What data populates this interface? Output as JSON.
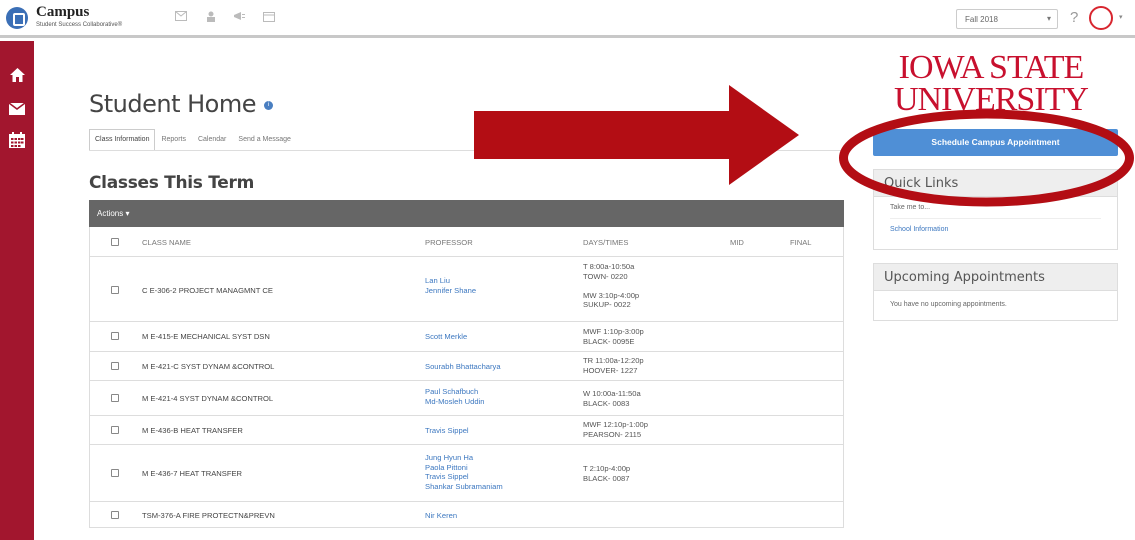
{
  "header": {
    "brand": "Campus",
    "brand_sub": "Student Success Collaborative®",
    "term": "Fall 2018",
    "help": "?"
  },
  "sidebar": {
    "items": [
      {
        "name": "home-icon"
      },
      {
        "name": "mail-icon"
      },
      {
        "name": "calendar-icon"
      }
    ]
  },
  "main": {
    "title": "Student Home",
    "tabs": [
      "Class Information",
      "Reports",
      "Calendar",
      "Send a Message"
    ],
    "section_title": "Classes This Term",
    "actions_label": "Actions ▾",
    "columns": [
      "CLASS NAME",
      "PROFESSOR",
      "DAYS/TIMES",
      "MID",
      "FINAL"
    ],
    "rows": [
      {
        "name": "C E-306-2 PROJECT MANAGMNT CE",
        "professors": [
          "Lan Liu",
          "Jennifer Shane"
        ],
        "days": [
          "T 8:00a-10:50a",
          "TOWN- 0220",
          "",
          "MW 3:10p-4:00p",
          "SUKUP- 0022"
        ]
      },
      {
        "name": "M E-415-E MECHANICAL SYST DSN",
        "professors": [
          "Scott Merkle"
        ],
        "days": [
          "MWF 1:10p-3:00p",
          "BLACK- 0095E"
        ]
      },
      {
        "name": "M E-421-C SYST DYNAM &CONTROL",
        "professors": [
          "Sourabh Bhattacharya"
        ],
        "days": [
          "TR 11:00a-12:20p",
          "HOOVER- 1227"
        ]
      },
      {
        "name": "M E-421-4 SYST DYNAM &CONTROL",
        "professors": [
          "Paul Schafbuch",
          "Md-Mosleh Uddin"
        ],
        "days": [
          "W 10:00a-11:50a",
          "BLACK- 0083"
        ]
      },
      {
        "name": "M E-436-B HEAT TRANSFER",
        "professors": [
          "Travis Sippel"
        ],
        "days": [
          "MWF 12:10p-1:00p",
          "PEARSON- 2115"
        ]
      },
      {
        "name": "M E-436-7 HEAT TRANSFER",
        "professors": [
          "Jung Hyun Ha",
          "Paola Pittoni",
          "Travis Sippel",
          "Shankar Subramaniam"
        ],
        "days": [
          "T 2:10p-4:00p",
          "BLACK- 0087"
        ]
      },
      {
        "name": "TSM-376-A FIRE PROTECTN&PREVN",
        "professors": [
          "Nir Keren"
        ],
        "days": []
      }
    ]
  },
  "right": {
    "logo_line1": "IOWA STATE",
    "logo_line2": "UNIVERSITY",
    "schedule_button": "Schedule Campus Appointment",
    "quick_links_title": "Quick Links",
    "quick_links_prompt": "Take me to...",
    "quick_links_item": "School Information",
    "upcoming_title": "Upcoming Appointments",
    "upcoming_text": "You have no upcoming appointments."
  },
  "colors": {
    "sidebar": "#a2162e",
    "accent_blue": "#4f8fd6",
    "annotation_red": "#b30d14",
    "isu_red": "#c8102e"
  }
}
